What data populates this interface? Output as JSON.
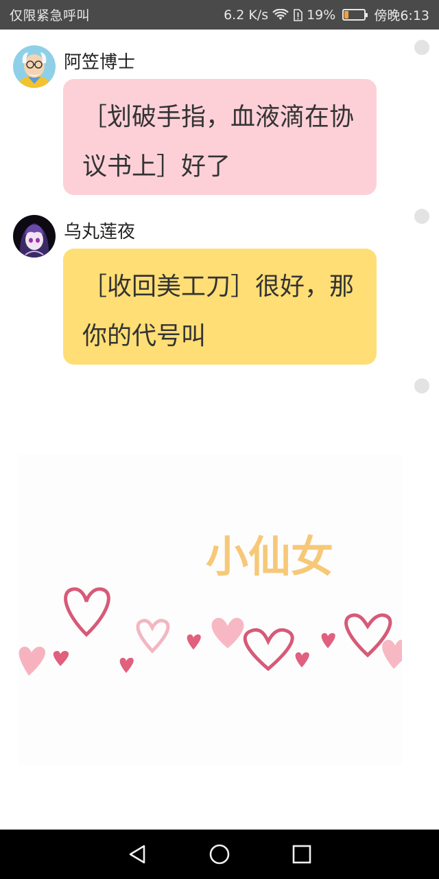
{
  "status_bar": {
    "left_text": "仅限紧急呼叫",
    "speed": "6.2 K/s",
    "battery_text": "19%",
    "battery_level": 0.19,
    "time": "傍晚6:13"
  },
  "messages": [
    {
      "sender": "阿笠博士",
      "text": "［划破手指，血液滴在协议书上］好了",
      "bubble_color": "#fdd0d8"
    },
    {
      "sender": "乌丸莲夜",
      "text": "［收回美工刀］很好，那你的代号叫",
      "bubble_color": "#fede75"
    }
  ],
  "sticker": {
    "text": "小仙女"
  },
  "nav_bar": {
    "icons": [
      "back-icon",
      "home-icon",
      "recents-icon"
    ]
  }
}
